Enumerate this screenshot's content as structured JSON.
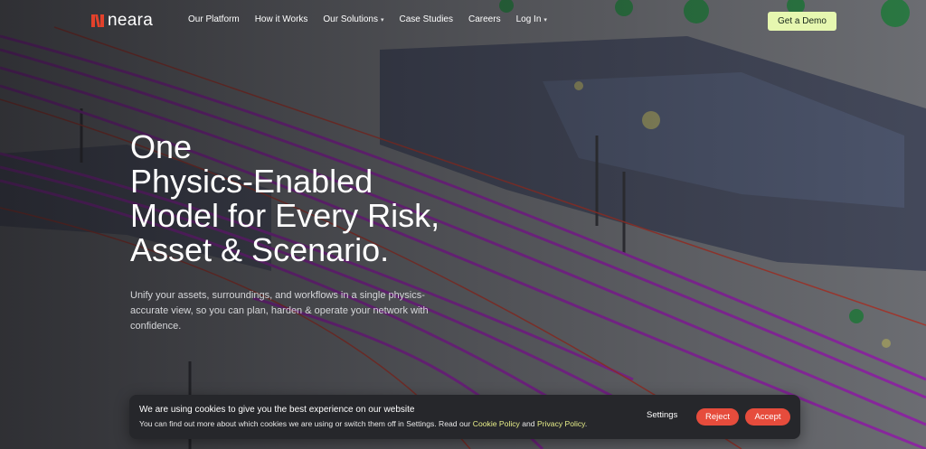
{
  "brand": {
    "name": "neara",
    "accent": "#e3412b"
  },
  "nav": {
    "items": [
      {
        "label": "Our Platform",
        "dropdown": false
      },
      {
        "label": "How it Works",
        "dropdown": false
      },
      {
        "label": "Our Solutions",
        "dropdown": true
      },
      {
        "label": "Case Studies",
        "dropdown": false
      },
      {
        "label": "Careers",
        "dropdown": false
      },
      {
        "label": "Log In",
        "dropdown": true
      }
    ],
    "cta": "Get a Demo",
    "cta_color": "#e6f7b0"
  },
  "hero": {
    "headline_lines": [
      "One",
      "Physics-Enabled",
      "Model for Every Risk,",
      "Asset & Scenario."
    ],
    "subtext": "Unify your assets, surroundings, and workflows in a single physics-accurate view, so you can plan, harden & operate your network with confidence."
  },
  "cookie": {
    "title": "We are using cookies to give you the best experience on our website",
    "text_prefix": "You can find out more about which cookies we are using or switch them off in Settings. Read our ",
    "cookie_policy": "Cookie Policy",
    "and": " and ",
    "privacy_policy": "Privacy Policy",
    "period": ".",
    "settings": "Settings",
    "reject": "Reject",
    "accept": "Accept",
    "button_color": "#e64c3c"
  }
}
